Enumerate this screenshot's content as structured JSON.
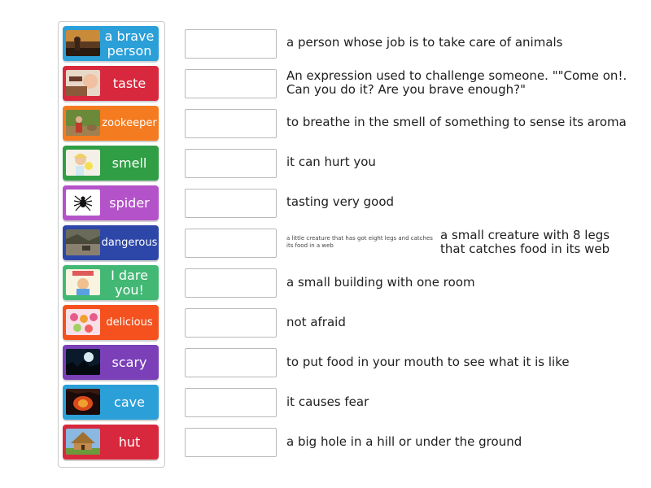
{
  "tiles": [
    {
      "label": "a brave person",
      "color": "#2a9fd8",
      "icon": "brave-person-photo"
    },
    {
      "label": "taste",
      "color": "#d8283d",
      "icon": "taste-photo"
    },
    {
      "label": "zookeeper",
      "color": "#f47b20",
      "icon": "zookeeper-photo"
    },
    {
      "label": "smell",
      "color": "#2f9e44",
      "icon": "smell-photo"
    },
    {
      "label": "spider",
      "color": "#b453c9",
      "icon": "spider-icon"
    },
    {
      "label": "dangerous",
      "color": "#2d47a8",
      "icon": "dangerous-photo"
    },
    {
      "label": "I dare you!",
      "color": "#42b874",
      "icon": "dare-book-cover"
    },
    {
      "label": "delicious",
      "color": "#f4511e",
      "icon": "delicious-photo"
    },
    {
      "label": "scary",
      "color": "#7b3fb8",
      "icon": "scary-photo"
    },
    {
      "label": "cave",
      "color": "#2a9fd8",
      "icon": "cave-photo"
    },
    {
      "label": "hut",
      "color": "#d8283d",
      "icon": "hut-photo"
    }
  ],
  "definitions": [
    {
      "text": "a person whose job is to take care of animals"
    },
    {
      "text": "An expression used to challenge someone. \"\"Come on!. Can you do it? Are you brave enough?\""
    },
    {
      "text": "to breathe in the smell of something to sense its aroma"
    },
    {
      "text": "it can hurt you"
    },
    {
      "text": "tasting very good"
    },
    {
      "text": "a small creature with 8 legs that catches food in its web",
      "image_text": "a little creature that has got eight legs and catches its food in a web"
    },
    {
      "text": "a small building with one room"
    },
    {
      "text": "not afraid"
    },
    {
      "text": "to put food in your mouth to see what it is like"
    },
    {
      "text": "it causes fear"
    },
    {
      "text": "a big hole in a hill or under the ground"
    }
  ]
}
